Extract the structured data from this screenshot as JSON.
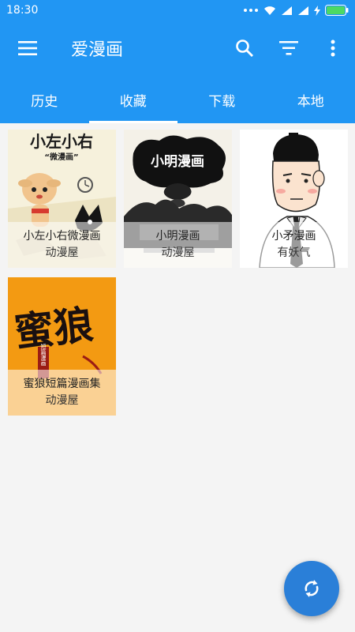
{
  "status": {
    "time": "18:30"
  },
  "app": {
    "title": "爱漫画",
    "icons": [
      "menu-icon",
      "search-icon",
      "filter-icon",
      "more-vert-icon"
    ]
  },
  "tabs": [
    {
      "label": "历史",
      "active": false
    },
    {
      "label": "收藏",
      "active": true
    },
    {
      "label": "下载",
      "active": false
    },
    {
      "label": "本地",
      "active": false
    }
  ],
  "comics": [
    {
      "title": "小左小右微漫画",
      "source": "动漫屋",
      "cover_text": "小左小右",
      "cover_subtext": "“微漫画”"
    },
    {
      "title": "小明漫画",
      "source": "动漫屋",
      "cover_text": "小明漫画"
    },
    {
      "title": "小矛漫画",
      "source": "有妖气"
    },
    {
      "title": "蜜狼短篇漫画集",
      "source": "动漫屋",
      "cover_text": "蜜狼",
      "cover_subtext": "短篇漫画"
    }
  ],
  "fab": {
    "icon": "sync-icon"
  },
  "colors": {
    "primary": "#2196f3",
    "fab": "#2a7fd8",
    "background": "#f4f4f4"
  }
}
